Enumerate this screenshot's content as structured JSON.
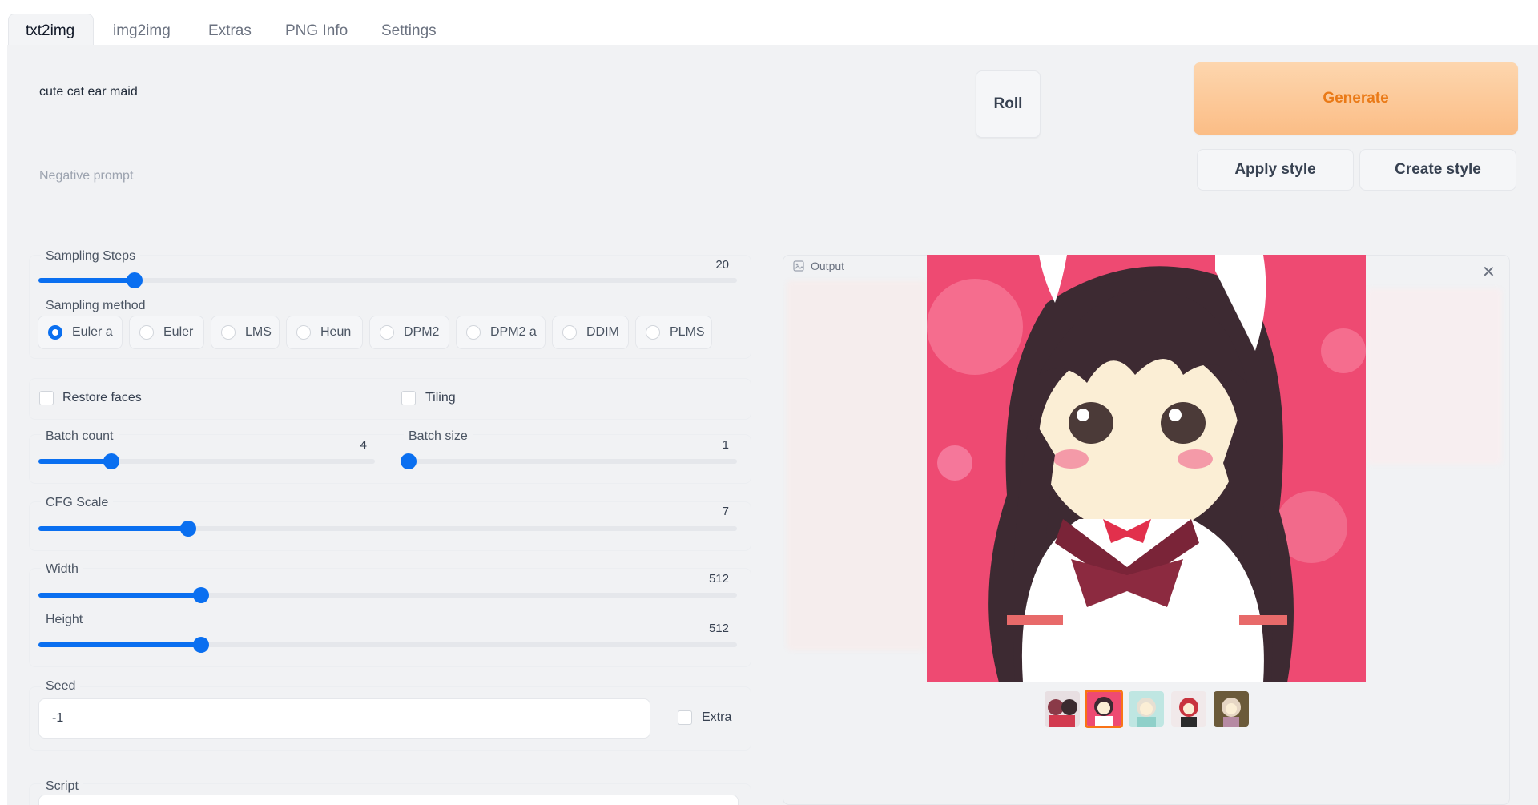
{
  "tabs": [
    {
      "label": "txt2img",
      "active": true
    },
    {
      "label": "img2img",
      "active": false
    },
    {
      "label": "Extras",
      "active": false
    },
    {
      "label": "PNG Info",
      "active": false
    },
    {
      "label": "Settings",
      "active": false
    }
  ],
  "prompt": {
    "value": "cute cat ear maid"
  },
  "negative_prompt": {
    "placeholder": "Negative prompt",
    "value": ""
  },
  "buttons": {
    "roll": "Roll",
    "generate": "Generate",
    "apply_style": "Apply style",
    "create_style": "Create style"
  },
  "sampling_steps": {
    "label": "Sampling Steps",
    "value": "20",
    "fraction": 0.135
  },
  "sampling_method": {
    "label": "Sampling method",
    "options": [
      "Euler a",
      "Euler",
      "LMS",
      "Heun",
      "DPM2",
      "DPM2 a",
      "DDIM",
      "PLMS"
    ],
    "selected": "Euler a"
  },
  "restore_faces": {
    "label": "Restore faces",
    "checked": false
  },
  "tiling": {
    "label": "Tiling",
    "checked": false
  },
  "batch_count": {
    "label": "Batch count",
    "value": "4",
    "fraction": 0.19
  },
  "batch_size": {
    "label": "Batch size",
    "value": "1",
    "fraction": 0.0
  },
  "cfg_scale": {
    "label": "CFG Scale",
    "value": "7",
    "fraction": 0.215
  },
  "width": {
    "label": "Width",
    "value": "512",
    "fraction": 0.23
  },
  "height": {
    "label": "Height",
    "value": "512",
    "fraction": 0.23
  },
  "seed": {
    "label": "Seed",
    "value": "-1"
  },
  "extra": {
    "label": "Extra",
    "checked": false
  },
  "script": {
    "label": "Script"
  },
  "output": {
    "label": "Output",
    "selected_thumbnail": 2,
    "thumbnail_count": 5
  },
  "colors": {
    "accent": "#0a6ff0",
    "generate_text": "#ea7a17",
    "thumb_selected": "#f97316"
  }
}
